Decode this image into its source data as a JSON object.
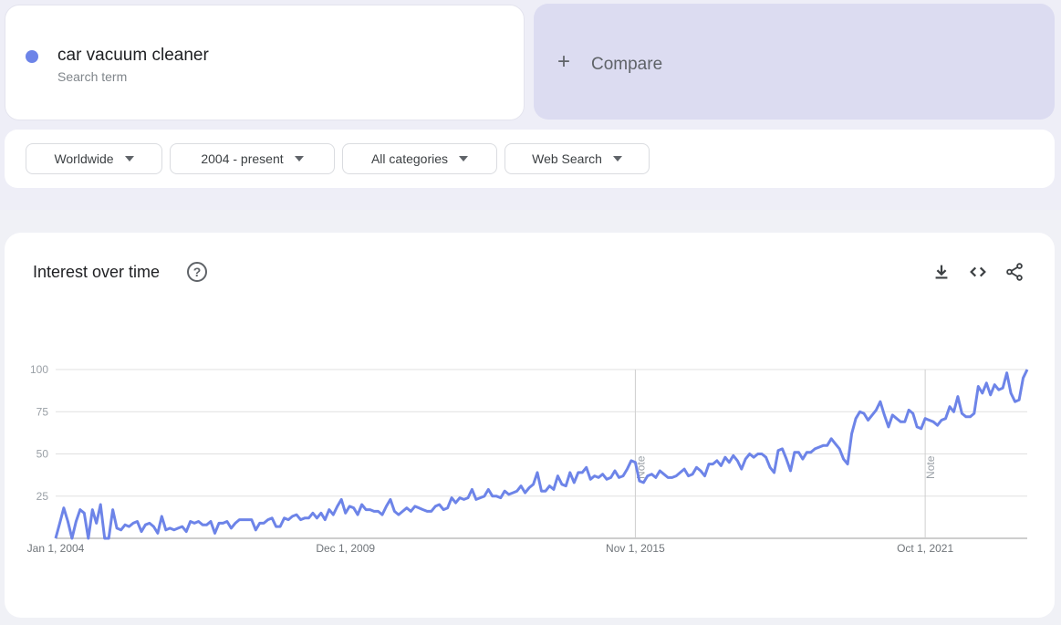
{
  "search_term": {
    "name": "car vacuum cleaner",
    "subtitle": "Search term",
    "color": "#6d84e8"
  },
  "compare": {
    "label": "Compare",
    "icon": "plus-icon"
  },
  "filters": [
    {
      "label": "Worldwide"
    },
    {
      "label": "2004 - present"
    },
    {
      "label": "All categories"
    },
    {
      "label": "Web Search"
    }
  ],
  "card": {
    "title": "Interest over time",
    "help_icon_glyph": "?",
    "actions": [
      "download-icon",
      "embed-icon",
      "share-icon"
    ]
  },
  "chart_data": {
    "type": "line",
    "title": "Interest over time",
    "xlabel": "",
    "ylabel": "",
    "ylim": [
      0,
      100
    ],
    "yticks": [
      25,
      50,
      75,
      100
    ],
    "grid": true,
    "line_color": "#6d84e8",
    "x_start": "2004-01",
    "x_end": "2023-06",
    "xtick_labels": [
      {
        "label": "Jan 1, 2004",
        "index": 0
      },
      {
        "label": "Dec 1, 2009",
        "index": 71
      },
      {
        "label": "Nov 1, 2015",
        "index": 142
      },
      {
        "label": "Oct 1, 2021",
        "index": 213
      }
    ],
    "notes": [
      {
        "label": "Note",
        "index": 142
      },
      {
        "label": "Note",
        "index": 213
      }
    ],
    "series": [
      {
        "name": "car vacuum cleaner",
        "values": [
          0,
          9,
          18,
          10,
          0,
          10,
          17,
          15,
          0,
          17,
          9,
          20,
          0,
          0,
          17,
          6,
          5,
          8,
          7,
          9,
          10,
          4,
          8,
          9,
          7,
          3,
          13,
          5,
          6,
          5,
          6,
          7,
          4,
          10,
          9,
          10,
          8,
          8,
          10,
          3,
          9,
          9,
          10,
          6,
          9,
          11,
          11,
          11,
          11,
          5,
          9,
          9,
          11,
          12,
          7,
          7,
          12,
          11,
          13,
          14,
          11,
          12,
          12,
          15,
          12,
          15,
          11,
          17,
          14,
          19,
          23,
          15,
          19,
          18,
          14,
          20,
          17,
          17,
          16,
          16,
          14,
          19,
          23,
          16,
          14,
          16,
          18,
          16,
          19,
          18,
          17,
          16,
          16,
          19,
          20,
          17,
          18,
          24,
          21,
          24,
          23,
          24,
          29,
          23,
          24,
          25,
          29,
          25,
          25,
          24,
          28,
          26,
          27,
          28,
          31,
          27,
          30,
          32,
          39,
          28,
          28,
          31,
          29,
          37,
          32,
          31,
          39,
          33,
          39,
          39,
          42,
          35,
          37,
          36,
          38,
          35,
          36,
          40,
          36,
          37,
          41,
          46,
          45,
          34,
          33,
          37,
          38,
          36,
          40,
          38,
          36,
          36,
          37,
          39,
          41,
          37,
          38,
          42,
          40,
          37,
          44,
          44,
          46,
          43,
          48,
          45,
          49,
          46,
          41,
          47,
          50,
          48,
          50,
          50,
          48,
          42,
          39,
          52,
          53,
          47,
          40,
          51,
          51,
          47,
          51,
          51,
          53,
          54,
          55,
          55,
          59,
          56,
          53,
          47,
          44,
          62,
          71,
          75,
          74,
          70,
          73,
          76,
          81,
          73,
          66,
          73,
          71,
          69,
          69,
          76,
          74,
          66,
          65,
          71,
          70,
          69,
          67,
          70,
          71,
          78,
          75,
          84,
          74,
          72,
          72,
          74,
          90,
          86,
          92,
          85,
          91,
          88,
          89,
          98,
          86,
          81,
          82,
          95,
          100
        ]
      }
    ]
  }
}
